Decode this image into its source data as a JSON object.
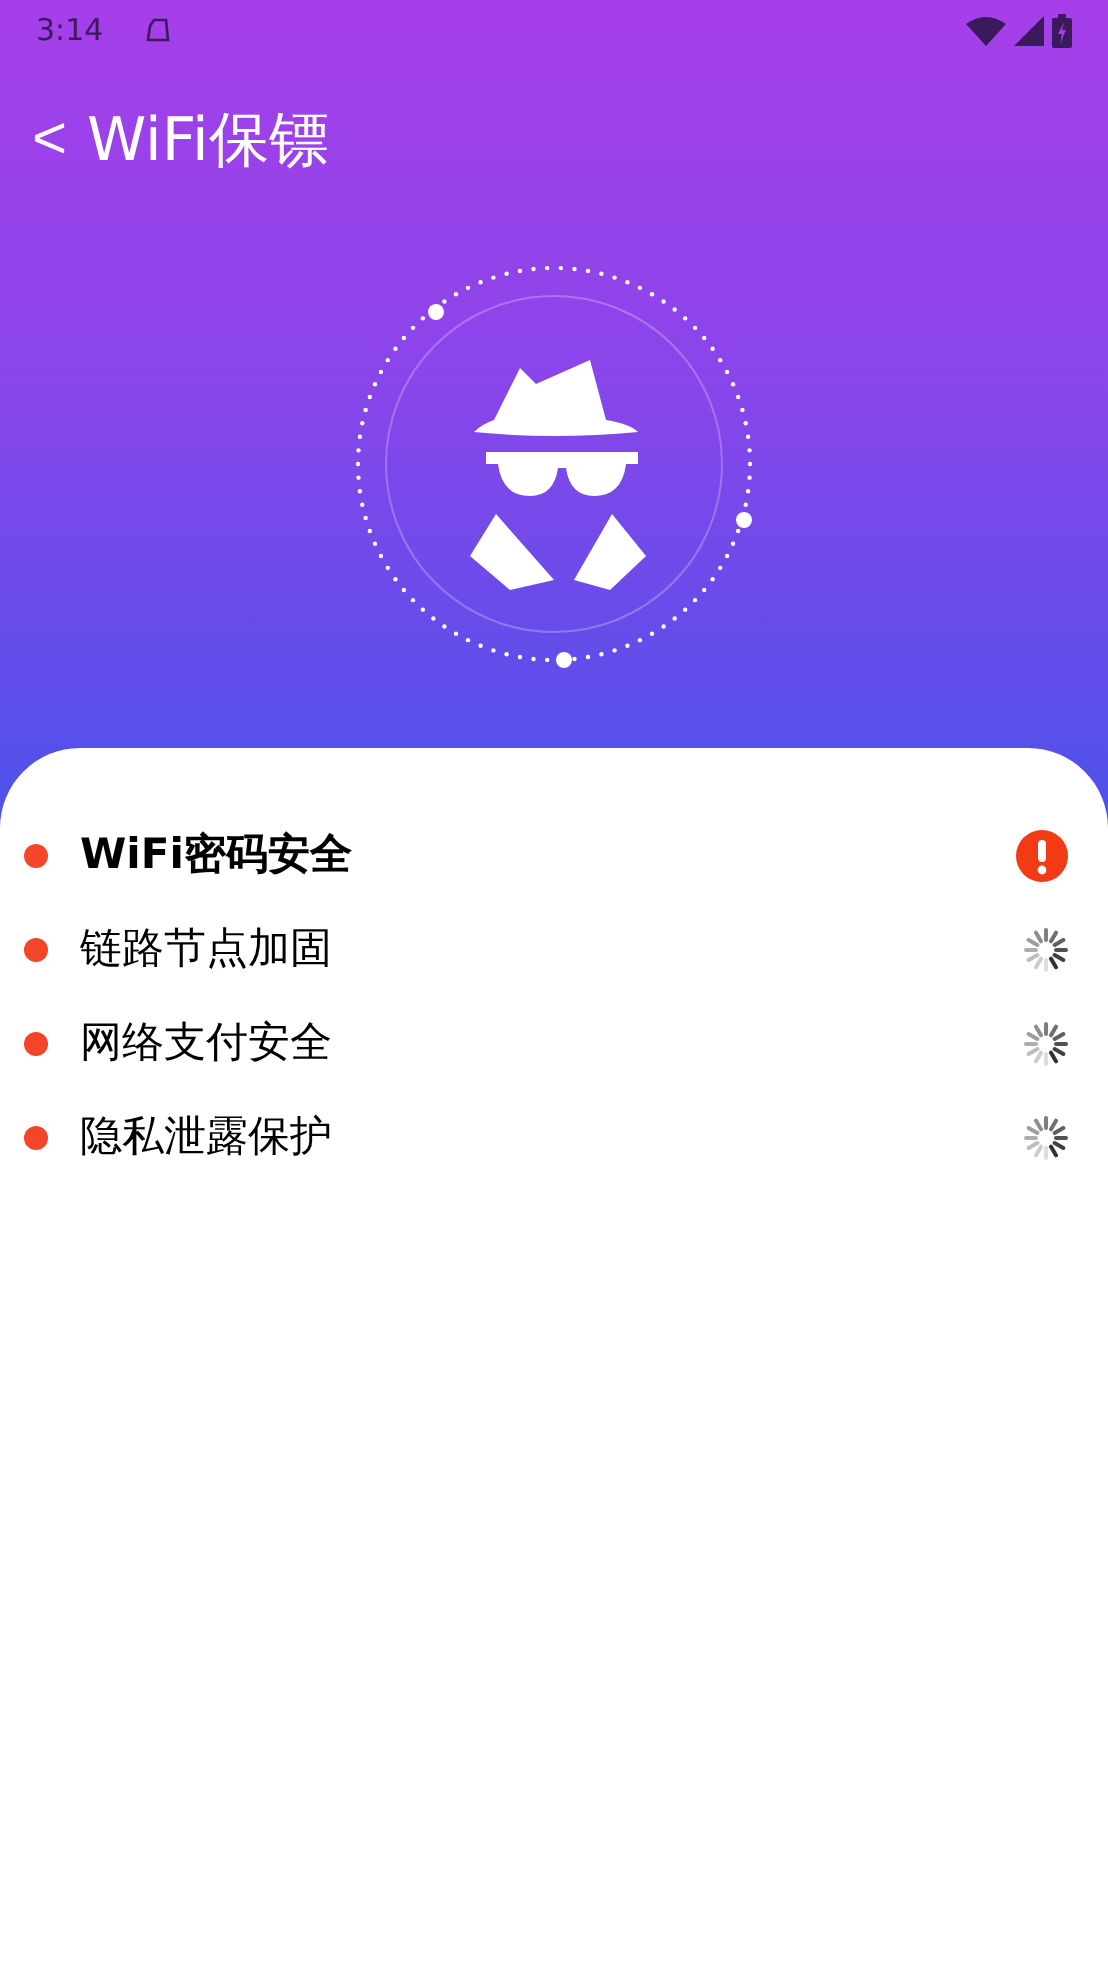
{
  "status_bar": {
    "time": "3:14"
  },
  "header": {
    "back": "<",
    "title": "WiFi保镖"
  },
  "checks": [
    {
      "label": "WiFi密码安全",
      "kind": "warning",
      "selected": true
    },
    {
      "label": "链路节点加固",
      "kind": "loading",
      "selected": false
    },
    {
      "label": "网络支付安全",
      "kind": "loading",
      "selected": false
    },
    {
      "label": "隐私泄露保护",
      "kind": "loading",
      "selected": false
    }
  ]
}
